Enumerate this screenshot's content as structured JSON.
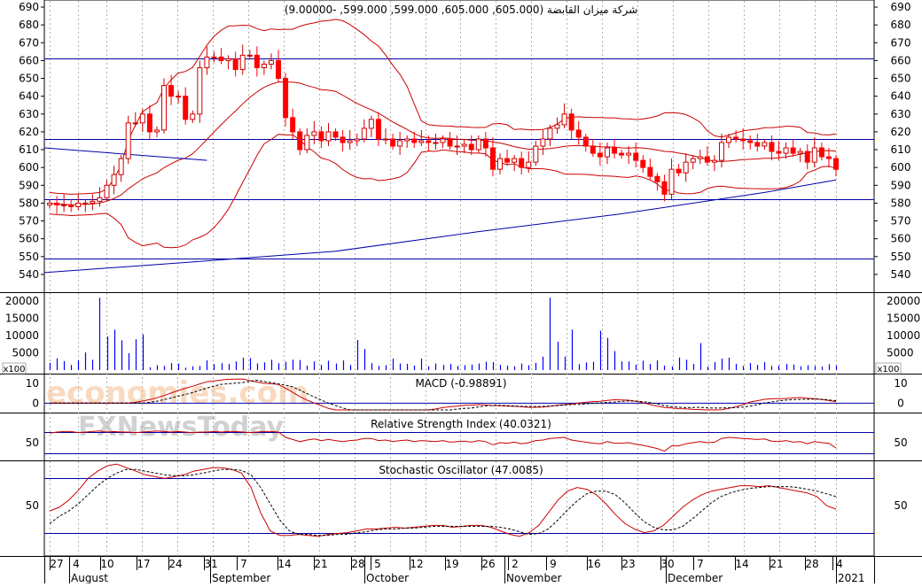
{
  "chart_data": [
    {
      "type": "candlestick",
      "title": "شركة ميزان القابضة (605.000, 605.000, 599.000, 599.000, -9.00000)",
      "y_ticks": [
        540,
        550,
        560,
        570,
        580,
        590,
        600,
        610,
        620,
        630,
        640,
        650,
        660,
        670,
        680,
        690
      ],
      "ylim": [
        535,
        692
      ],
      "horizontal_lines": [
        661,
        616,
        582,
        549
      ],
      "candles_close": [
        580,
        579,
        579,
        578,
        580,
        580,
        581,
        583,
        590,
        596,
        605,
        625,
        625,
        630,
        620,
        621,
        646,
        640,
        640,
        627,
        630,
        656,
        662,
        662,
        660,
        661,
        655,
        663,
        663,
        656,
        658,
        660,
        650,
        628,
        620,
        610,
        618,
        620,
        615,
        620,
        617,
        614,
        615,
        616,
        622,
        627,
        616,
        616,
        612,
        615,
        616,
        614,
        615,
        614,
        614,
        616,
        612,
        612,
        613,
        610,
        616,
        611,
        599,
        605,
        603,
        605,
        600,
        603,
        612,
        616,
        622,
        624,
        630,
        621,
        617,
        612,
        608,
        606,
        611,
        608,
        607,
        608,
        604,
        600,
        595,
        592,
        585,
        599,
        597,
        603,
        605,
        606,
        603,
        604,
        614,
        617,
        616,
        615,
        614,
        612,
        614,
        609,
        608,
        611,
        608,
        609,
        603,
        611,
        606,
        605,
        599
      ],
      "markers": [
        "upper band",
        "lower band",
        "middle average",
        "long-term average",
        "trend line"
      ]
    },
    {
      "type": "bar",
      "title": "Volume",
      "y_ticks": [
        5000,
        10000,
        15000,
        20000
      ],
      "unit_label": "x100",
      "values": [
        2100,
        3400,
        2600,
        1500,
        2800,
        5100,
        3000,
        20900,
        9700,
        11700,
        8600,
        4900,
        8900,
        10300,
        800,
        1400,
        1200,
        2000,
        1900,
        700,
        1100,
        1200,
        2800,
        1700,
        2000,
        1800,
        2500,
        3600,
        3500,
        1900,
        2200,
        3000,
        2000,
        2400,
        3000,
        2900,
        1300,
        2500,
        1500,
        2700,
        1900,
        2800,
        1500,
        8700,
        6100,
        2000,
        1200,
        1400,
        3300,
        1900,
        1800,
        1300,
        3300,
        1100,
        1900,
        1500,
        1800,
        1200,
        1400,
        1600,
        1900,
        2400,
        2300,
        1500,
        1300,
        1100,
        1900,
        1400,
        2100,
        3900,
        20900,
        8200,
        3900,
        11700,
        1700,
        2200,
        2400,
        11400,
        9300,
        5500,
        2500,
        2500,
        1600,
        2700,
        1800,
        2800,
        1300,
        1100,
        3600,
        3000,
        1800,
        7800,
        1000,
        2300,
        3300,
        3600,
        1800,
        1200,
        2000,
        1500,
        2300,
        1200,
        1300,
        1800,
        1600,
        1100,
        1400,
        1200,
        1000,
        1700,
        1300
      ]
    },
    {
      "type": "line",
      "title": "MACD (-0.98891)",
      "y_ticks": [
        0,
        10
      ],
      "ylim": [
        -3,
        15
      ]
    },
    {
      "type": "line",
      "title": "Relative Strength Index (40.0321)",
      "y_ticks": [
        50
      ],
      "levels": [
        70,
        30
      ],
      "values": [
        68,
        70,
        71,
        71,
        69,
        70,
        71,
        72,
        70,
        71,
        70,
        70,
        69,
        70,
        71,
        72,
        71,
        70,
        71,
        70,
        69,
        70,
        70,
        71,
        70,
        71,
        71,
        70,
        69,
        70,
        71,
        71,
        70,
        60,
        56,
        52,
        55,
        57,
        54,
        56,
        54,
        52,
        54,
        55,
        58,
        58,
        54,
        55,
        52,
        54,
        55,
        52,
        54,
        53,
        52,
        54,
        51,
        52,
        53,
        51,
        54,
        52,
        46,
        50,
        49,
        51,
        48,
        50,
        54,
        55,
        58,
        59,
        60,
        55,
        53,
        51,
        49,
        48,
        52,
        49,
        49,
        50,
        47,
        45,
        42,
        39,
        34,
        44,
        44,
        48,
        50,
        52,
        50,
        51,
        58,
        60,
        59,
        58,
        57,
        56,
        57,
        53,
        52,
        54,
        51,
        52,
        48,
        52,
        50,
        49,
        40
      ]
    },
    {
      "type": "line",
      "title": "Stochastic Oscillator (47.0085)",
      "y_ticks": [
        50
      ],
      "levels": [
        80,
        20
      ],
      "values": [
        44,
        48,
        56,
        67,
        80,
        88,
        94,
        96,
        92,
        88,
        84,
        82,
        80,
        82,
        84,
        88,
        90,
        92,
        92,
        90,
        86,
        70,
        42,
        22,
        17,
        17,
        18,
        17,
        16,
        18,
        19,
        20,
        22,
        24,
        24,
        25,
        26,
        25,
        26,
        27,
        28,
        28,
        26,
        27,
        28,
        28,
        26,
        22,
        18,
        16,
        20,
        28,
        42,
        56,
        66,
        70,
        68,
        62,
        52,
        40,
        30,
        24,
        20,
        22,
        28,
        38,
        48,
        56,
        62,
        66,
        68,
        70,
        72,
        72,
        71,
        72,
        70,
        68,
        66,
        64,
        60,
        50,
        46
      ],
      "signal": [
        30,
        38,
        44,
        52,
        62,
        72,
        80,
        86,
        90,
        90,
        88,
        86,
        84,
        83,
        83,
        84,
        86,
        88,
        90,
        90,
        89,
        84,
        70,
        52,
        34,
        22,
        18,
        18,
        17,
        17,
        18,
        18,
        20,
        21,
        23,
        24,
        24,
        25,
        25,
        26,
        27,
        27,
        27,
        27,
        27,
        27,
        27,
        26,
        24,
        21,
        18,
        19,
        24,
        34,
        45,
        55,
        63,
        66,
        66,
        62,
        53,
        42,
        32,
        26,
        23,
        23,
        27,
        35,
        44,
        53,
        60,
        64,
        67,
        69,
        70,
        71,
        71,
        71,
        70,
        68,
        66,
        63,
        60
      ]
    }
  ],
  "x_axis": {
    "day_ticks": [
      "27",
      "4",
      "10",
      "17",
      "24",
      "31",
      "7",
      "14",
      "21",
      "28",
      "5",
      "12",
      "19",
      "26",
      "2",
      "9",
      "16",
      "23",
      "30",
      "7",
      "14",
      "21",
      "28",
      "4"
    ],
    "months": [
      "August",
      "September",
      "October",
      "November",
      "December",
      "2021"
    ]
  },
  "watermarks": [
    "economies.com",
    "FXNewsToday"
  ],
  "colors": {
    "up_candle": "#0000ff",
    "down_candle": "#ff0000",
    "hollow_candle": "#cc0000",
    "band_line": "#cc0000",
    "blue_line": "#0000aa",
    "grid": "#b0b0b0",
    "level_line": "#0000aa"
  }
}
